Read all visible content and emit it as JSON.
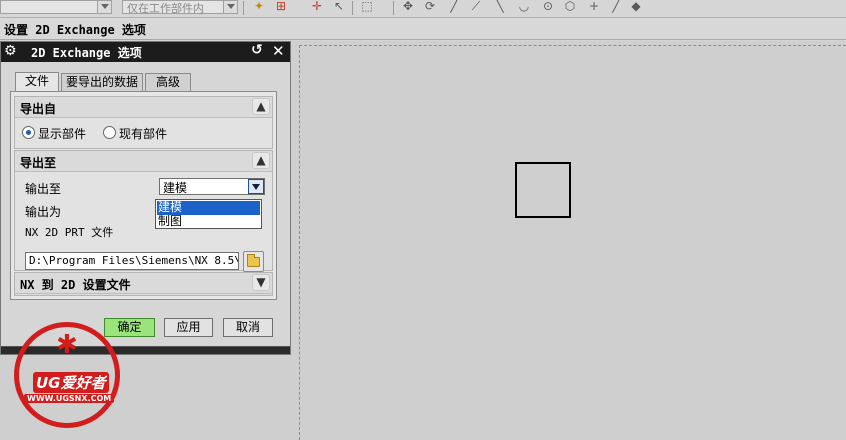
{
  "toolbar": {
    "combo1_value": "",
    "combo2_value": "仅在工作部件内",
    "icons": [
      "snap-icon",
      "filter-icon",
      "point-icon",
      "select-icon",
      "box-select-icon",
      "move-icon",
      "rotate-icon",
      "line-icon",
      "arc-icon",
      "curve-icon",
      "circle-icon",
      "polygon-icon",
      "plus-icon",
      "pen-icon",
      "cube-icon"
    ]
  },
  "status": {
    "prompt": "设置 2D Exchange 选项"
  },
  "dialog": {
    "title": "2D Exchange 选项",
    "tabs": [
      "文件",
      "要导出的数据",
      "高级"
    ],
    "export_from": {
      "header": "导出自",
      "options": [
        "显示部件",
        "现有部件"
      ],
      "selected_index": 0
    },
    "export_to": {
      "header": "导出至",
      "output_to_label": "输出至",
      "output_to_value": "建模",
      "output_as_label": "输出为",
      "dropdown_options": [
        "建模",
        "制图"
      ],
      "dropdown_selected_index": 0,
      "file_label": "NX 2D PRT 文件",
      "file_path": "D:\\Program Files\\Siemens\\NX 8.5\\UGI"
    },
    "settings_file": {
      "header": "NX 到 2D 设置文件"
    },
    "buttons": {
      "ok": "确定",
      "apply": "应用",
      "cancel": "取消"
    }
  },
  "watermark": {
    "brand": "UG爱好者",
    "url": "WWW.UGSNX.COM"
  },
  "colors": {
    "title_bar": "#1c1c1c",
    "ok_button": "#9be47c",
    "selection": "#1b63c9",
    "watermark": "#d31c1c"
  }
}
